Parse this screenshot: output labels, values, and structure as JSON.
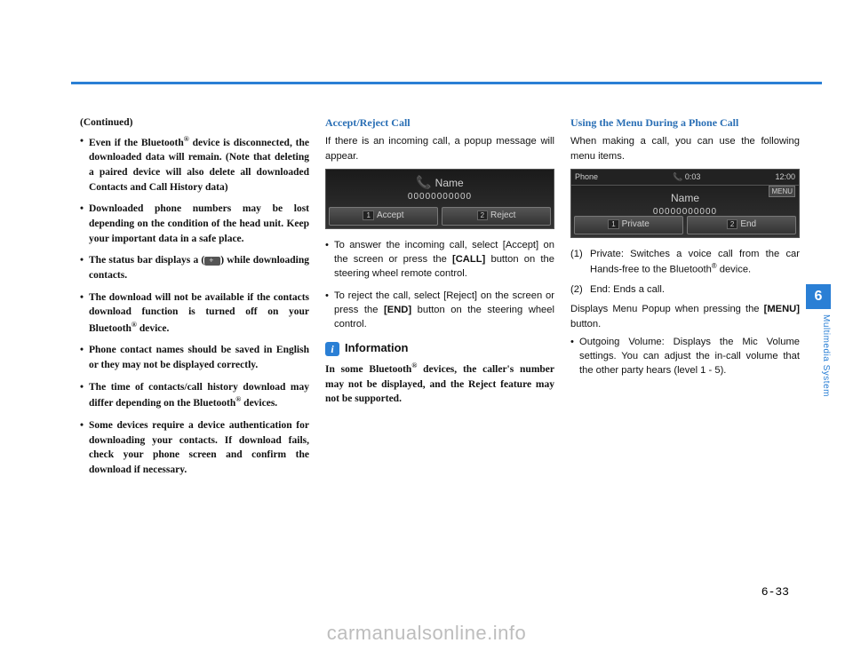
{
  "col1": {
    "continued": "(Continued)",
    "b1a": "Even if the Bluetooth",
    "b1b": " device is disconnected, the downloaded data will remain. (Note that deleting a paired device will also delete all downloaded Contacts and Call History data)",
    "b2": "Downloaded phone numbers may be lost depending on the condition of the head unit. Keep your important data in a safe place.",
    "b3a": "The status bar displays a (",
    "b3b": ") while downloading contacts.",
    "b4a": "The download will not be available if the contacts download function is turned off on your Bluetooth",
    "b4b": " device.",
    "b5": "Phone contact names should be saved in English or they may not be displayed correctly.",
    "b6a": "The time of contacts/call history download may differ depending on the Bluetooth",
    "b6b": " devices.",
    "b7": "Some devices require a device authentication for downloading your contacts. If download fails, check your phone screen and confirm the download if necessary."
  },
  "col2": {
    "heading": "Accept/Reject Call",
    "intro": "If there is an incoming call, a popup message will appear.",
    "shot": {
      "name": "Name",
      "num": "00000000000",
      "btn1": "Accept",
      "btn2": "Reject"
    },
    "pb1a": "To answer the incoming call, select [Accept] on the screen or press the ",
    "pb1b": "[CALL]",
    "pb1c": " button on the steering wheel remote control.",
    "pb2a": "To reject the call, select [Reject] on the screen or press the ",
    "pb2b": "[END]",
    "pb2c": " button on the steering wheel control.",
    "infoLabel": "Information",
    "infoTextA": "In some Bluetooth",
    "infoTextB": " devices, the caller's number may not be displayed, and the Reject feature may not be supported."
  },
  "col3": {
    "heading": "Using the Menu During a Phone Call",
    "intro": "When making a call, you can use the following menu items.",
    "shot": {
      "hdrL": "Phone",
      "hdrC": "0:03",
      "hdrR": "12:00",
      "name": "Name",
      "num": "00000000000",
      "btn1": "Private",
      "btn2": "End",
      "menu": "MENU"
    },
    "n1a": "Private: Switches a voice call from the car Hands-free to the Bluetooth",
    "n1b": " device.",
    "n2": "End: Ends a call.",
    "midA": "Displays Menu Popup when pressing the ",
    "midB": "[MENU]",
    "midC": " button.",
    "ov": "Outgoing Volume: Displays the Mic Volume settings. You can adjust the in-call volume that the other party hears (level 1 - 5)."
  },
  "sidebar": {
    "num": "6",
    "label": "Multimedia System"
  },
  "pagenum": "6-33",
  "watermark": "carmanualsonline.info",
  "reg": "®"
}
